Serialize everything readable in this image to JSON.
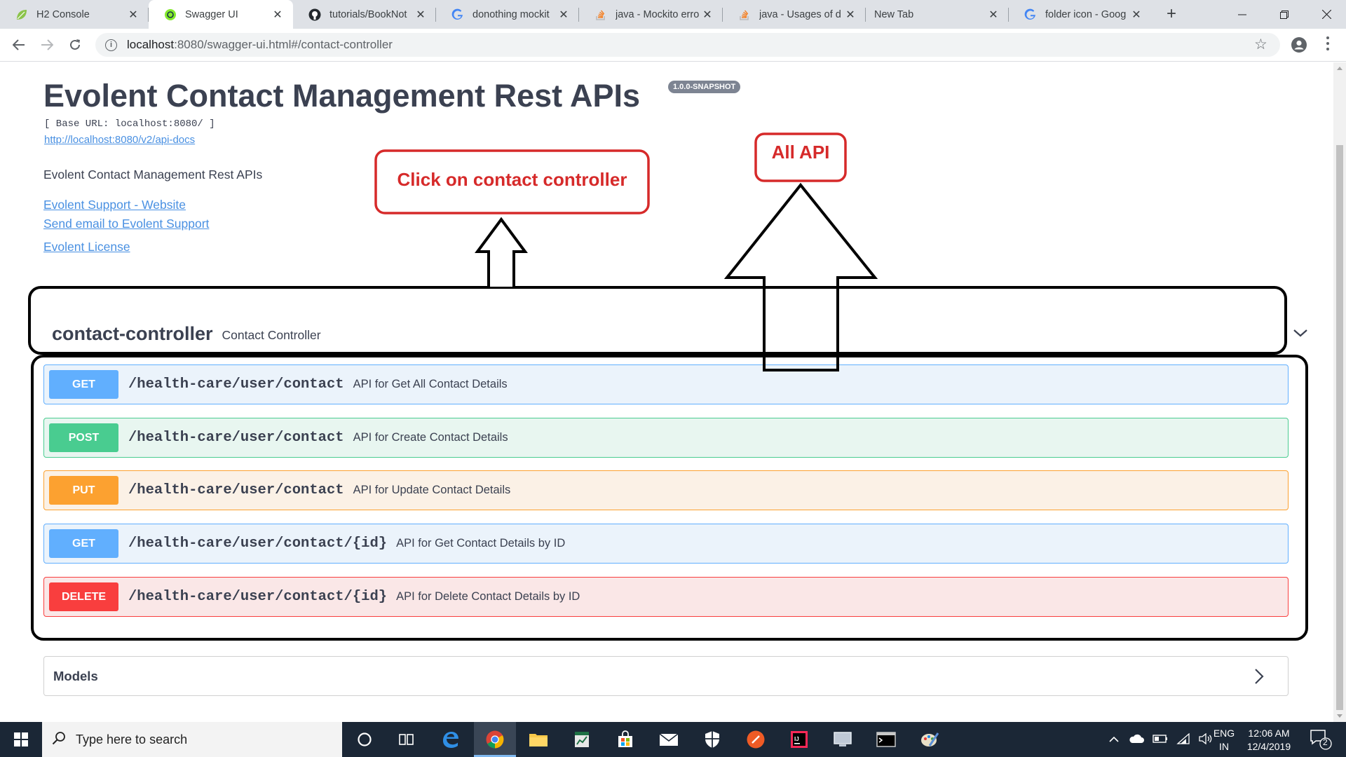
{
  "browser": {
    "tabs": [
      {
        "title": "H2 Console",
        "icon": "leaf-favicon"
      },
      {
        "title": "Swagger UI",
        "icon": "swagger-favicon"
      },
      {
        "title": "tutorials/BookNot",
        "icon": "github-favicon"
      },
      {
        "title": "donothing mockit",
        "icon": "google-favicon"
      },
      {
        "title": "java - Mockito erro",
        "icon": "stackoverflow-favicon"
      },
      {
        "title": "java - Usages of d",
        "icon": "stackoverflow-favicon"
      },
      {
        "title": "New Tab",
        "icon": ""
      },
      {
        "title": "folder icon - Goog",
        "icon": "google-favicon"
      }
    ],
    "active_tab": 1,
    "url_host": "localhost",
    "url_path": ":8080/swagger-ui.html#/contact-controller"
  },
  "swagger": {
    "title": "Evolent Contact Management Rest APIs",
    "version": "1.0.0-SNAPSHOT",
    "base_url": "[ Base URL: localhost:8080/ ]",
    "spec_link": "http://localhost:8080/v2/api-docs",
    "description": "Evolent Contact Management Rest APIs",
    "links": [
      "Evolent Support - Website",
      "Send email to Evolent Support",
      "Evolent License"
    ],
    "tag": {
      "name": "contact-controller",
      "description": "Contact Controller"
    },
    "operations": [
      {
        "method": "GET",
        "path": "/health-care/user/contact",
        "summary": "API for Get All Contact Details"
      },
      {
        "method": "POST",
        "path": "/health-care/user/contact",
        "summary": "API for Create Contact Details"
      },
      {
        "method": "PUT",
        "path": "/health-care/user/contact",
        "summary": "API for Update Contact Details"
      },
      {
        "method": "GET",
        "path": "/health-care/user/contact/{id}",
        "summary": "API for Get Contact Details by ID"
      },
      {
        "method": "DELETE",
        "path": "/health-care/user/contact/{id}",
        "summary": "API for Delete Contact Details by ID"
      }
    ],
    "models_label": "Models"
  },
  "annotations": {
    "callout_left": "Click on contact controller",
    "callout_right": "All API",
    "color": "#d62a2a"
  },
  "taskbar": {
    "search_placeholder": "Type here to search",
    "lang_top": "ENG",
    "lang_bottom": "IN",
    "time": "12:06 AM",
    "date": "12/4/2019",
    "notification_count": "2"
  },
  "colors": {
    "get": "#61affe",
    "post": "#49cc90",
    "put": "#fca130",
    "delete": "#f93e3e",
    "link": "#4990e2"
  }
}
